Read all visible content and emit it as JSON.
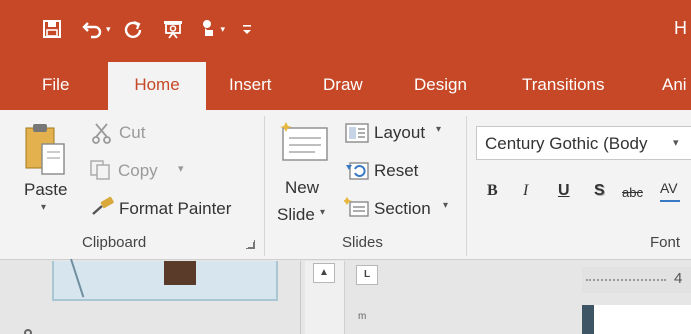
{
  "title_bar": {
    "title_fragment": "H",
    "quick_access": [
      {
        "name": "save-icon"
      },
      {
        "name": "undo-icon"
      },
      {
        "name": "redo-icon"
      },
      {
        "name": "present-from-start-icon"
      },
      {
        "name": "touch-mode-icon"
      },
      {
        "name": "customize-qat-icon"
      }
    ]
  },
  "tabs": [
    {
      "label": "File",
      "active": false
    },
    {
      "label": "Home",
      "active": true
    },
    {
      "label": "Insert",
      "active": false
    },
    {
      "label": "Draw",
      "active": false
    },
    {
      "label": "Design",
      "active": false
    },
    {
      "label": "Transitions",
      "active": false
    },
    {
      "label": "Ani",
      "active": false
    }
  ],
  "clipboard": {
    "paste_label": "Paste",
    "cut_label": "Cut",
    "copy_label": "Copy",
    "format_painter_label": "Format Painter",
    "group_label": "Clipboard"
  },
  "slides": {
    "new_slide_line1": "New",
    "new_slide_line2": "Slide",
    "layout_label": "Layout",
    "reset_label": "Reset",
    "section_label": "Section",
    "group_label": "Slides"
  },
  "font": {
    "font_name": "Century Gothic (Body",
    "bold": "B",
    "italic": "I",
    "underline": "U",
    "shadow": "S",
    "strikethrough": "abc",
    "spacing": "AV",
    "group_label": "Font"
  },
  "ruler": {
    "tick_number": "4"
  },
  "colors": {
    "accent": "#c64826",
    "ribbon_bg": "#f3f3f3",
    "active_tab_text": "#c64826"
  }
}
